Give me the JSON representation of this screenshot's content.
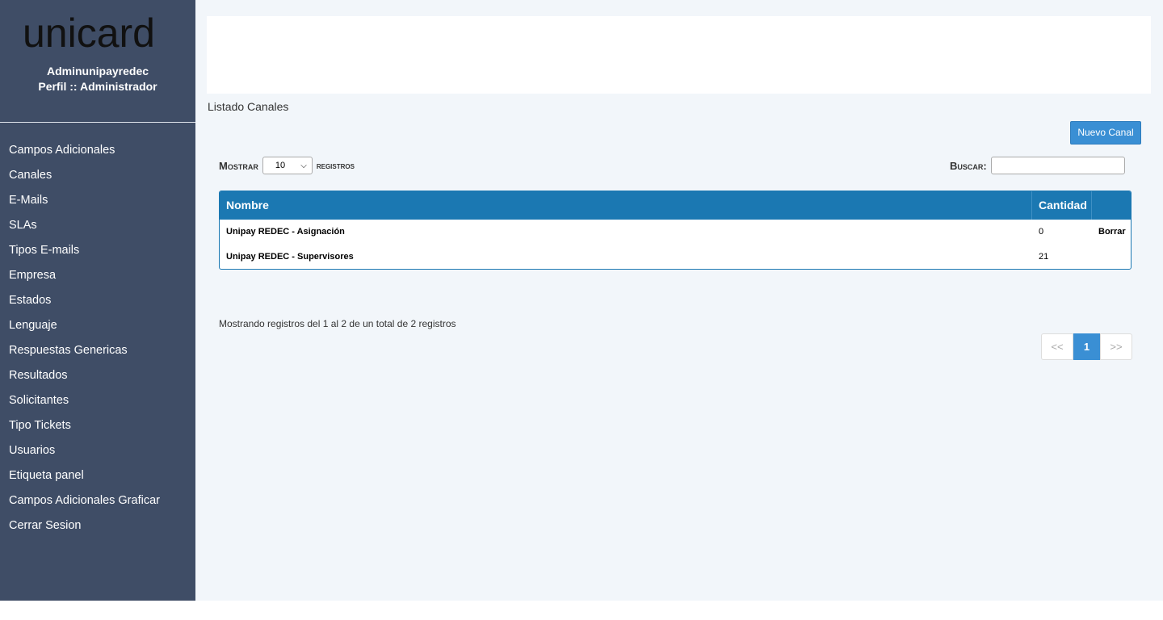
{
  "brand": {
    "logo_text": "unicard"
  },
  "user": {
    "name": "Adminunipayredec",
    "profile": "Perfil :: Administrador"
  },
  "sidebar": {
    "items": [
      {
        "label": "Campos Adicionales"
      },
      {
        "label": "Canales"
      },
      {
        "label": "E-Mails"
      },
      {
        "label": "SLAs"
      },
      {
        "label": "Tipos E-mails"
      },
      {
        "label": "Empresa"
      },
      {
        "label": "Estados"
      },
      {
        "label": "Lenguaje"
      },
      {
        "label": "Respuestas Genericas"
      },
      {
        "label": "Resultados"
      },
      {
        "label": "Solicitantes"
      },
      {
        "label": "Tipo Tickets"
      },
      {
        "label": "Usuarios"
      },
      {
        "label": "Etiqueta panel"
      },
      {
        "label": "Campos Adicionales Graficar"
      },
      {
        "label": "Cerrar Sesion"
      }
    ]
  },
  "main": {
    "page_title": "Listado Canales",
    "new_button": "Nuevo Canal",
    "length": {
      "label_before": "Mostrar",
      "selected": "10",
      "label_after": "registros"
    },
    "search": {
      "label": "Buscar:",
      "value": ""
    },
    "table": {
      "headers": [
        "Nombre",
        "Cantidad",
        ""
      ],
      "rows": [
        {
          "name": "Unipay REDEC - Asignación",
          "qty": "0",
          "action": "Borrar"
        },
        {
          "name": "Unipay REDEC - Supervisores",
          "qty": "21",
          "action": ""
        }
      ]
    },
    "info": "Mostrando registros del 1 al 2 de un total de 2 registros",
    "pagination": {
      "prev": "<<",
      "current": "1",
      "next": ">>"
    }
  },
  "colors": {
    "sidebar_bg": "#3f4d66",
    "main_bg": "#f2f6fa",
    "table_header": "#1b78b2",
    "accent": "#3a8fd4"
  }
}
